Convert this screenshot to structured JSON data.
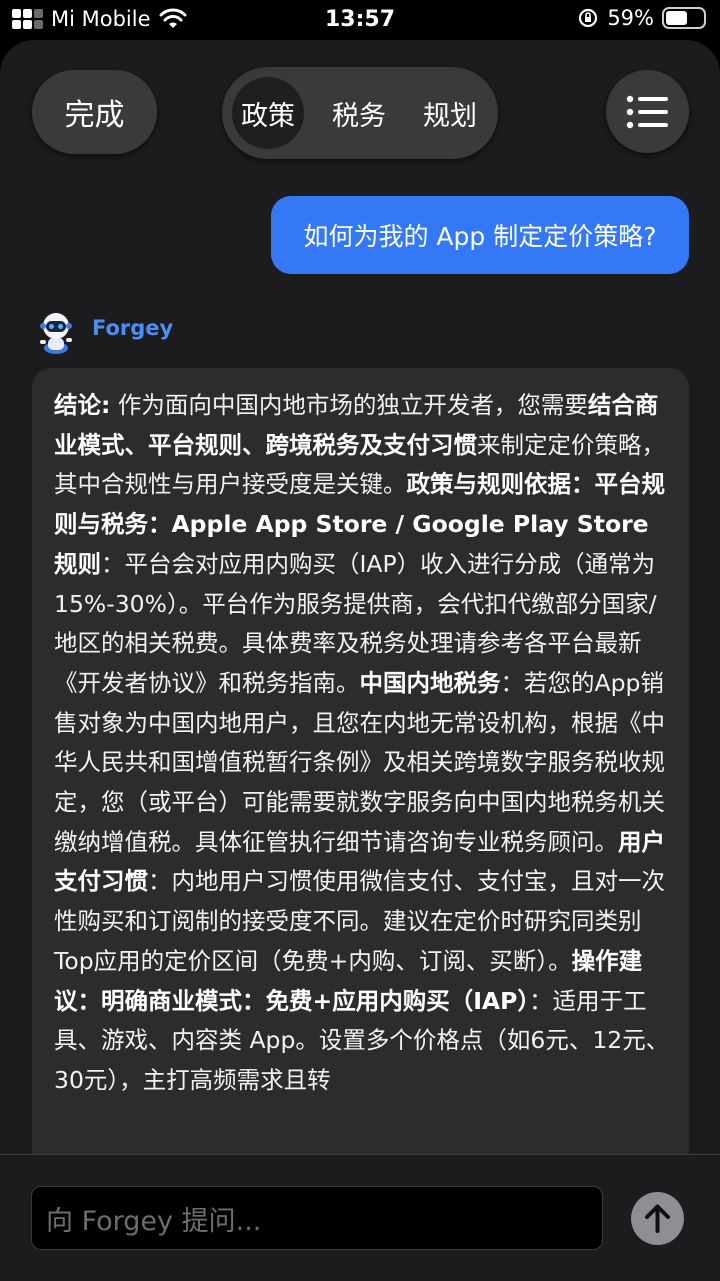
{
  "status_bar": {
    "carrier": "Mi Mobile",
    "time": "13:57",
    "battery_percent": "59%",
    "battery_level": 0.59
  },
  "header": {
    "done_label": "完成",
    "tabs": [
      {
        "label": "政策",
        "active": true
      },
      {
        "label": "税务",
        "active": false
      },
      {
        "label": "规划",
        "active": false
      }
    ],
    "menu_icon": "menu-list-icon"
  },
  "chat": {
    "user_message": "如何为我的 App 制定定价策略?",
    "bot_name": "Forgey",
    "answer_segments": [
      {
        "text": "结论:",
        "bold": true
      },
      {
        "text": " 作为面向中国内地市场的独立开发者，您需要",
        "bold": false
      },
      {
        "text": "结合商业模式、平台规则、跨境税务及支付习惯",
        "bold": true
      },
      {
        "text": "来制定定价策略，其中合规性与用户接受度是关键。",
        "bold": false
      },
      {
        "text": "政策与规则依据：平台规则与税务：Apple App Store / Google Play Store 规则",
        "bold": true
      },
      {
        "text": "：平台会对应用内购买（IAP）收入进行分成（通常为15%-30%）。平台作为服务提供商，会代扣代缴部分国家/地区的相关税费。具体费率及税务处理请参考各平台最新《开发者协议》和税务指南。",
        "bold": false
      },
      {
        "text": "中国内地税务",
        "bold": true
      },
      {
        "text": "：若您的App销售对象为中国内地用户，且您在内地无常设机构，根据《中华人民共和国增值税暂行条例》及相关跨境数字服务税收规定，您（或平台）可能需要就数字服务向中国内地税务机关缴纳增值税。具体征管执行细节请咨询专业税务顾问。",
        "bold": false
      },
      {
        "text": "用户支付习惯",
        "bold": true
      },
      {
        "text": "：内地用户习惯使用微信支付、支付宝，且对一次性购买和订阅制的接受度不同。建议在定价时研究同类别Top应用的定价区间（免费+内购、订阅、买断）。",
        "bold": false
      },
      {
        "text": "操作建议：明确商业模式：免费+应用内购买（IAP）",
        "bold": true
      },
      {
        "text": "：适用于工具、游戏、内容类 App。设置多个价格点（如6元、12元、30元），主打高频需求且转",
        "bold": false
      }
    ]
  },
  "composer": {
    "placeholder": "向 Forgey 提问...",
    "send_icon": "arrow-up-icon"
  },
  "colors": {
    "accent_blue": "#3478f6",
    "bot_name_blue": "#4b8ef5",
    "sheet_bg": "#1c1c1e",
    "card_bg": "#2c2c2e"
  }
}
